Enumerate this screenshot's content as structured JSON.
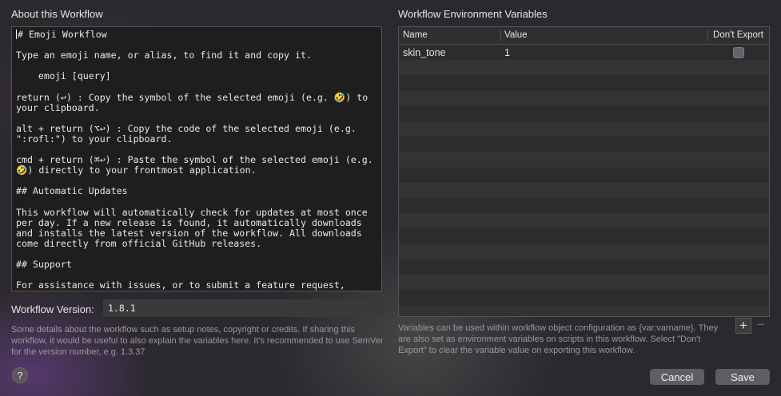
{
  "about": {
    "title": "About this Workflow",
    "text": "# Emoji Workflow\n\nType an emoji name, or alias, to find it and copy it.\n\n    emoji [query]\n\nreturn (↩) : Copy the symbol of the selected emoji (e.g. 🤣) to your clipboard.\n\nalt + return (⌥↩) : Copy the code of the selected emoji (e.g. \":rofl:\") to your clipboard.\n\ncmd + return (⌘↩) : Paste the symbol of the selected emoji (e.g. 🤣) directly to your frontmost application.\n\n## Automatic Updates\n\nThis workflow will automatically check for updates at most once per day. If a new release is found, it automatically downloads and installs the latest version of the workflow. All downloads come directly from official GitHub releases.\n\n## Support\n\nFor assistance with issues, or to submit a feature request, please",
    "version_label": "Workflow Version:",
    "version_value": "1.8.1",
    "help": "Some details about the workflow such as setup notes, copyright or credits. If sharing this workflow, it would be useful to also explain the variables here. It's recommended to use SemVer for the version number, e.g. 1.3.37"
  },
  "variables": {
    "title": "Workflow Environment Variables",
    "columns": {
      "name": "Name",
      "value": "Value",
      "dont_export": "Don't Export"
    },
    "rows": [
      {
        "name": "skin_tone",
        "value": "1",
        "dont_export": false
      }
    ],
    "help": "Variables can be used within workflow object configuration as {var:varname}. They are also set as environment variables on scripts in this workflow. Select \"Don't Export\" to clear the variable value on exporting this workflow.",
    "add_label": "+",
    "remove_label": "−"
  },
  "footer": {
    "help_label": "?",
    "cancel_label": "Cancel",
    "save_label": "Save"
  }
}
